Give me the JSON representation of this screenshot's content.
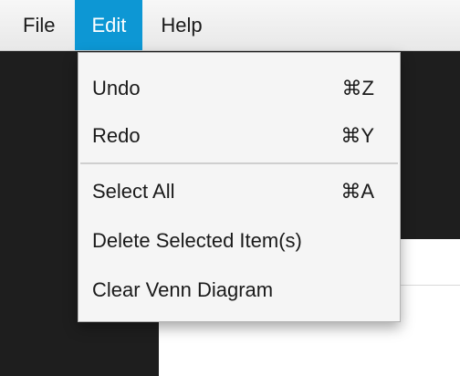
{
  "menubar": {
    "items": [
      {
        "label": "File"
      },
      {
        "label": "Edit",
        "active": true
      },
      {
        "label": "Help"
      }
    ]
  },
  "edit_menu": {
    "items": [
      {
        "label": "Undo",
        "shortcut": "⌘Z"
      },
      {
        "label": "Redo",
        "shortcut": "⌘Y"
      },
      {
        "label": "Select All",
        "shortcut": "⌘A"
      },
      {
        "label": "Delete Selected Item(s)",
        "shortcut": ""
      },
      {
        "label": "Clear Venn Diagram",
        "shortcut": ""
      }
    ]
  },
  "colors": {
    "active_menu": "#0d97d4",
    "menu_background": "#f5f5f5",
    "app_background": "#1e1e1e"
  }
}
